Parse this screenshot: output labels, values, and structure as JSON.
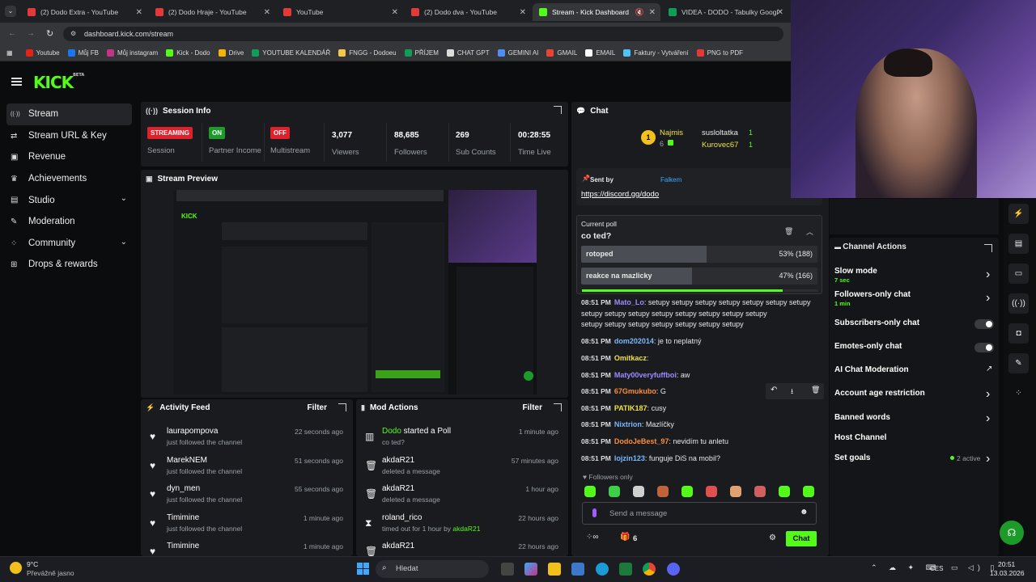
{
  "browser": {
    "tabs": [
      {
        "title": "(2) Dodo Extra - YouTube"
      },
      {
        "title": "(2) Dodo Hraje - YouTube"
      },
      {
        "title": "YouTube"
      },
      {
        "title": "(2) Dodo dva - YouTube"
      },
      {
        "title": "Stream - Kick Dashboard"
      },
      {
        "title": "VIDEA - DODO - Tabulky Googl"
      }
    ],
    "url": "dashboard.kick.com/stream",
    "bookmarks": [
      {
        "label": "Youtube",
        "color": "#e62117"
      },
      {
        "label": "Můj FB",
        "color": "#1877f2"
      },
      {
        "label": "Můj instagram",
        "color": "#c13584"
      },
      {
        "label": "Kick - Dodo",
        "color": "#53fc18"
      },
      {
        "label": "Drive",
        "color": "#f4b400"
      },
      {
        "label": "YOUTUBE KALENDÁŘ",
        "color": "#0f9d58"
      },
      {
        "label": "FNGG - Dodoeu",
        "color": "#f2c94c"
      },
      {
        "label": "PŘÍJEM",
        "color": "#0f9d58"
      },
      {
        "label": "CHAT GPT",
        "color": "#dddddd"
      },
      {
        "label": "GEMINI AI",
        "color": "#4f8df5"
      },
      {
        "label": "GMAIL",
        "color": "#ea4335"
      },
      {
        "label": "EMAIL",
        "color": "#ffffff"
      },
      {
        "label": "Faktury - Vytváření",
        "color": "#4fc3f7"
      },
      {
        "label": "PNG to PDF",
        "color": "#e53935"
      }
    ]
  },
  "logo": "KICK",
  "logo_beta": "BETA",
  "sidebar": {
    "items": [
      {
        "label": "Stream",
        "icon": "broadcast-icon"
      },
      {
        "label": "Stream URL & Key",
        "icon": "link-icon"
      },
      {
        "label": "Revenue",
        "icon": "revenue-icon"
      },
      {
        "label": "Achievements",
        "icon": "trophy-icon"
      },
      {
        "label": "Studio",
        "icon": "studio-icon"
      },
      {
        "label": "Moderation",
        "icon": "wrench-icon"
      },
      {
        "label": "Community",
        "icon": "people-icon"
      },
      {
        "label": "Drops & rewards",
        "icon": "gift-icon"
      }
    ]
  },
  "session": {
    "title": "Session Info",
    "streaming": "STREAMING",
    "session_label": "Session",
    "on": "ON",
    "partner_label": "Partner Income",
    "off": "OFF",
    "multistream_label": "Multistream",
    "viewers": "3,077",
    "viewers_label": "Viewers",
    "followers": "88,685",
    "followers_label": "Followers",
    "subs": "269",
    "subs_label": "Sub Counts",
    "time": "00:28:55",
    "time_label": "Time Live"
  },
  "preview": {
    "title": "Stream Preview"
  },
  "activity": {
    "title": "Activity Feed",
    "filter": "Filter",
    "items": [
      {
        "name": "laurapompova",
        "action": "just followed the channel",
        "time": "22 seconds ago"
      },
      {
        "name": "MarekNEM",
        "action": "just followed the channel",
        "time": "51 seconds ago"
      },
      {
        "name": "dyn_men",
        "action": "just followed the channel",
        "time": "55 seconds ago"
      },
      {
        "name": "Timimine",
        "action": "just followed the channel",
        "time": "1 minute ago"
      },
      {
        "name": "Timimine",
        "action": "",
        "time": "1 minute ago"
      }
    ]
  },
  "mod": {
    "title": "Mod Actions",
    "filter": "Filter",
    "items": [
      {
        "name": "Dodo",
        "verb": " started a Poll",
        "sub": "co ted?",
        "time": "1 minute ago",
        "icon": "poll-icon"
      },
      {
        "name": "akdaR21",
        "verb": "",
        "sub": "deleted a message",
        "time": "57 minutes ago",
        "icon": "trash-icon"
      },
      {
        "name": "akdaR21",
        "verb": "",
        "sub": "deleted a message",
        "time": "1 hour ago",
        "icon": "trash-icon"
      },
      {
        "name": "roland_rico",
        "verb": "",
        "sub": "timed out for 1 hour by ",
        "sub_by": "akdaR21",
        "time": "22 hours ago",
        "icon": "hourglass-icon"
      },
      {
        "name": "akdaR21",
        "verb": "",
        "sub": "",
        "time": "22 hours ago",
        "icon": "trash-icon"
      }
    ]
  },
  "chat": {
    "title": "Chat",
    "leaderboard": {
      "top1": "Najmis",
      "top1_count": "6",
      "top2": "susloltatka",
      "top2_count": "1",
      "top3": "Kurovec67",
      "top3_count": "1"
    },
    "pinned": {
      "sent_by": "Sent by",
      "sender": "Falkem",
      "link": "https://discord.gg/dodo"
    },
    "poll": {
      "label": "Current poll",
      "question": "co ted?",
      "options": [
        {
          "label": "rotoped",
          "result": "53% (188)",
          "pct": 53
        },
        {
          "label": "reakce na mazlicky",
          "result": "47% (166)",
          "pct": 47
        }
      ],
      "time_left_fraction": 0.85
    },
    "messages": [
      {
        "time": "08:51 PM",
        "user": "Mato_Lo",
        "color": "#9b8cff",
        "text": "setupy setupy setupy setupy setupy setupy setupy"
      },
      {
        "time": "",
        "user": "",
        "color": "",
        "text": "setupy setupy setupy setupy setupy setupy setupy setupy"
      },
      {
        "time": "",
        "user": "",
        "color": "",
        "text": "setupy setupy setupy setupy setupy setupy setupy"
      },
      {
        "time": "08:51 PM",
        "user": "dom202014",
        "color": "#7ab8ff",
        "text": "je to neplatný"
      },
      {
        "time": "08:51 PM",
        "user": "Omitkacz",
        "color": "#f0e04a",
        "text": ""
      },
      {
        "time": "08:51 PM",
        "user": "Maty00veryfuffboi",
        "color": "#9b8cff",
        "text": "aw"
      },
      {
        "time": "08:51 PM",
        "user": "67Gmukubo",
        "color": "#ff8c3a",
        "text": "G"
      },
      {
        "time": "08:51 PM",
        "user": "PATIK187",
        "color": "#f0e04a",
        "text": "cusy"
      },
      {
        "time": "08:51 PM",
        "user": "Nixtrion",
        "color": "#7ab8ff",
        "text": "Mazlíčky"
      },
      {
        "time": "08:51 PM",
        "user": "DodoJeBest_97",
        "color": "#ff8c3a",
        "text": "nevidím tu anletu"
      },
      {
        "time": "08:51 PM",
        "user": "lojzin123",
        "color": "#7ab8ff",
        "text": "funguje DiS na mobil?"
      }
    ],
    "followers_only": "Followers only",
    "input_placeholder": "Send a message",
    "gift_count": "6",
    "chat_button": "Chat"
  },
  "channel_actions": {
    "title": "Channel Actions",
    "rows": [
      {
        "label": "Slow mode",
        "sub": "7 sec",
        "control": "arrow"
      },
      {
        "label": "Followers-only chat",
        "sub": "1 min",
        "control": "arrow"
      },
      {
        "label": "Subscribers-only chat",
        "sub": "",
        "control": "toggle"
      },
      {
        "label": "Emotes-only chat",
        "sub": "",
        "control": "toggle"
      },
      {
        "label": "AI Chat Moderation",
        "sub": "",
        "control": "external"
      },
      {
        "label": "Account age restriction",
        "sub": "",
        "control": "arrow"
      },
      {
        "label": "Banned words",
        "sub": "",
        "control": "arrow"
      },
      {
        "label": "Host Channel",
        "sub": "",
        "control": "none"
      },
      {
        "label": "Set goals",
        "sub": "",
        "control": "arrow",
        "status": "2 active"
      }
    ]
  },
  "taskbar": {
    "weather_temp": "9°C",
    "weather_desc": "Převážně jasno",
    "search": "Hledat",
    "lang": "CES",
    "time": "20:51",
    "date": "13.03.2026"
  },
  "colors": {
    "kick_green": "#53fc18",
    "streaming_red": "#e0202a"
  }
}
